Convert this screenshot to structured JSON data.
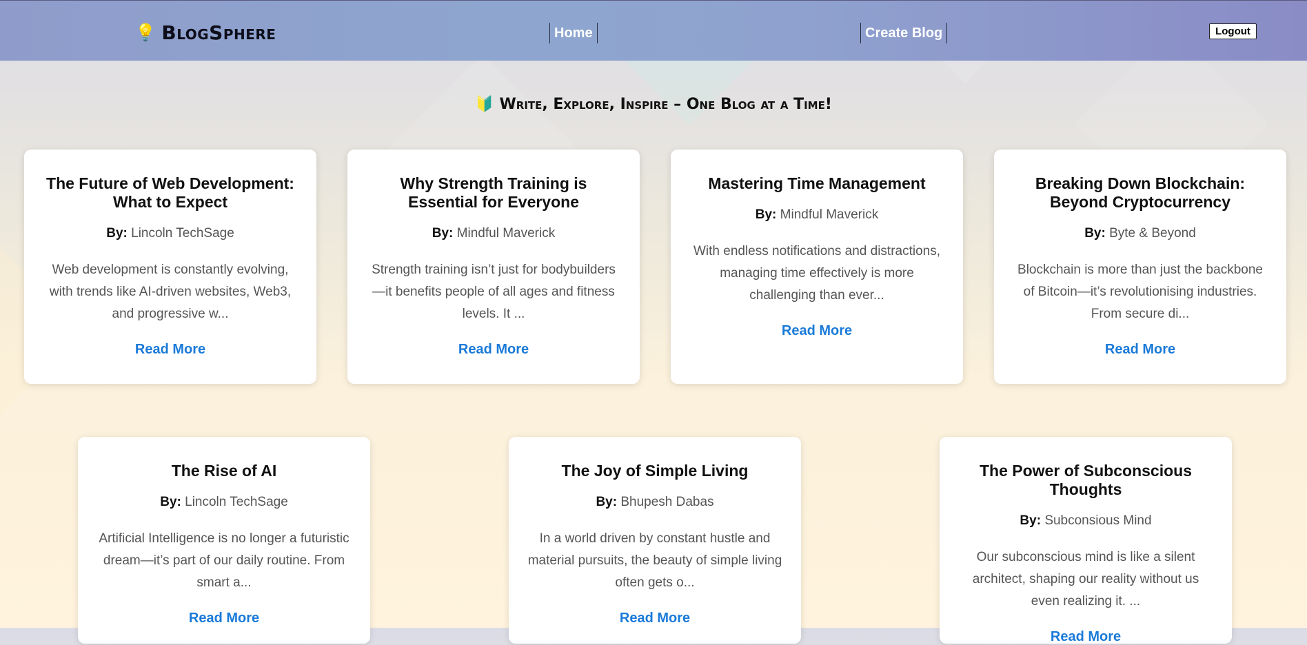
{
  "header": {
    "brand_icon": "lightbulb-icon",
    "brand_emoji": "💡",
    "brand_name": "BlogSphere",
    "nav": {
      "home": "Home",
      "create": "Create Blog"
    },
    "logout": "Logout"
  },
  "tagline": {
    "icon": "beginner-leaf-icon",
    "emoji": "🔰",
    "text": "Write, Explore, Inspire – One Blog at a Time!"
  },
  "blogs": [
    {
      "title": "The Future of Web Development: What to Expect",
      "by_label": "By:",
      "author": "Lincoln TechSage",
      "excerpt": "Web development is constantly evolving, with trends like AI-driven websites, Web3, and progressive w...",
      "read_more": "Read More"
    },
    {
      "title": "Why Strength Training is Essential for Everyone",
      "by_label": "By:",
      "author": "Mindful Maverick",
      "excerpt": "Strength training isn’t just for bodybuilders—it benefits people of all ages and fitness levels. It ...",
      "read_more": "Read More"
    },
    {
      "title": "Mastering Time Management",
      "by_label": "By:",
      "author": "Mindful Maverick",
      "excerpt": "With endless notifications and distractions, managing time effectively is more challenging than ever...",
      "read_more": "Read More"
    },
    {
      "title": "Breaking Down Blockchain: Beyond Cryptocurrency",
      "by_label": "By:",
      "author": "Byte & Beyond",
      "excerpt": "Blockchain is more than just the backbone of Bitcoin—it’s revolutionising industries. From secure di...",
      "read_more": "Read More"
    },
    {
      "title": "The Rise of AI",
      "by_label": "By:",
      "author": "Lincoln TechSage",
      "excerpt": "Artificial Intelligence is no longer a futuristic dream—it’s part of our daily routine. From smart a...",
      "read_more": "Read More"
    },
    {
      "title": "The Joy of Simple Living",
      "by_label": "By:",
      "author": "Bhupesh Dabas",
      "excerpt": "In a world driven by constant hustle and material pursuits, the beauty of simple living often gets o...",
      "read_more": "Read More"
    },
    {
      "title": "The Power of Subconscious Thoughts",
      "by_label": "By:",
      "author": "Subconsious Mind",
      "excerpt": "Our subconscious mind is like a silent architect, shaping our reality without us even realizing it. ...",
      "read_more": "Read More"
    }
  ],
  "colors": {
    "accent": "#1a7ad8",
    "header_bg": "#8ea6cf"
  }
}
